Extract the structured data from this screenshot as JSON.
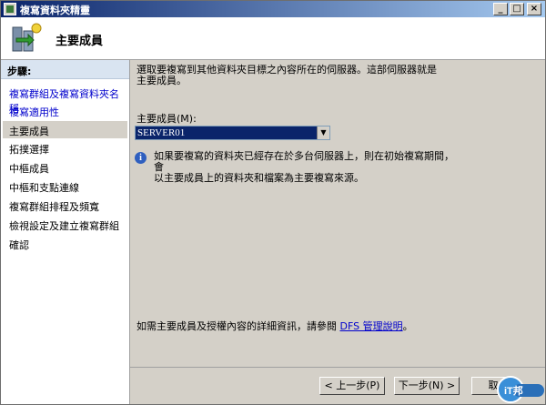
{
  "window": {
    "title": "複寫資料夾精靈"
  },
  "header": {
    "title": "主要成員"
  },
  "sidebar": {
    "steps_label": "步驟:",
    "items": [
      {
        "label": "複寫群組及複寫資料夾名稱",
        "state": "link"
      },
      {
        "label": "複寫適用性",
        "state": "link"
      },
      {
        "label": "主要成員",
        "state": "active"
      },
      {
        "label": "拓撲選擇",
        "state": "normal"
      },
      {
        "label": "中樞成員",
        "state": "normal"
      },
      {
        "label": "中樞和支點連線",
        "state": "normal"
      },
      {
        "label": "複寫群組排程及頻寬",
        "state": "normal"
      },
      {
        "label": "檢視設定及建立複寫群組",
        "state": "normal"
      },
      {
        "label": "確認",
        "state": "normal"
      }
    ]
  },
  "main": {
    "intro_line1": "選取要複寫到其他資料夾目標之內容所在的伺服器。這部伺服器就是",
    "intro_line2": "主要成員。",
    "member_label": "主要成員(M):",
    "member_value": "SERVER01",
    "info_line1": "如果要複寫的資料夾已經存在於多台伺服器上，則在初始複寫期間，會",
    "info_line2": "以主要成員上的資料夾和檔案為主要複寫來源。",
    "footer_prefix": "如需主要成員及授權內容的詳細資訊，請參閱",
    "footer_link": "DFS 管理說明",
    "footer_suffix": "。"
  },
  "buttons": {
    "back": "< 上一步(P)",
    "next": "下一步(N) >",
    "cancel": "取"
  },
  "watermark": {
    "text": "iT邦"
  },
  "colors": {
    "selection": "#0a246a",
    "link": "#0000cc",
    "titlebar": "#0a246a"
  }
}
